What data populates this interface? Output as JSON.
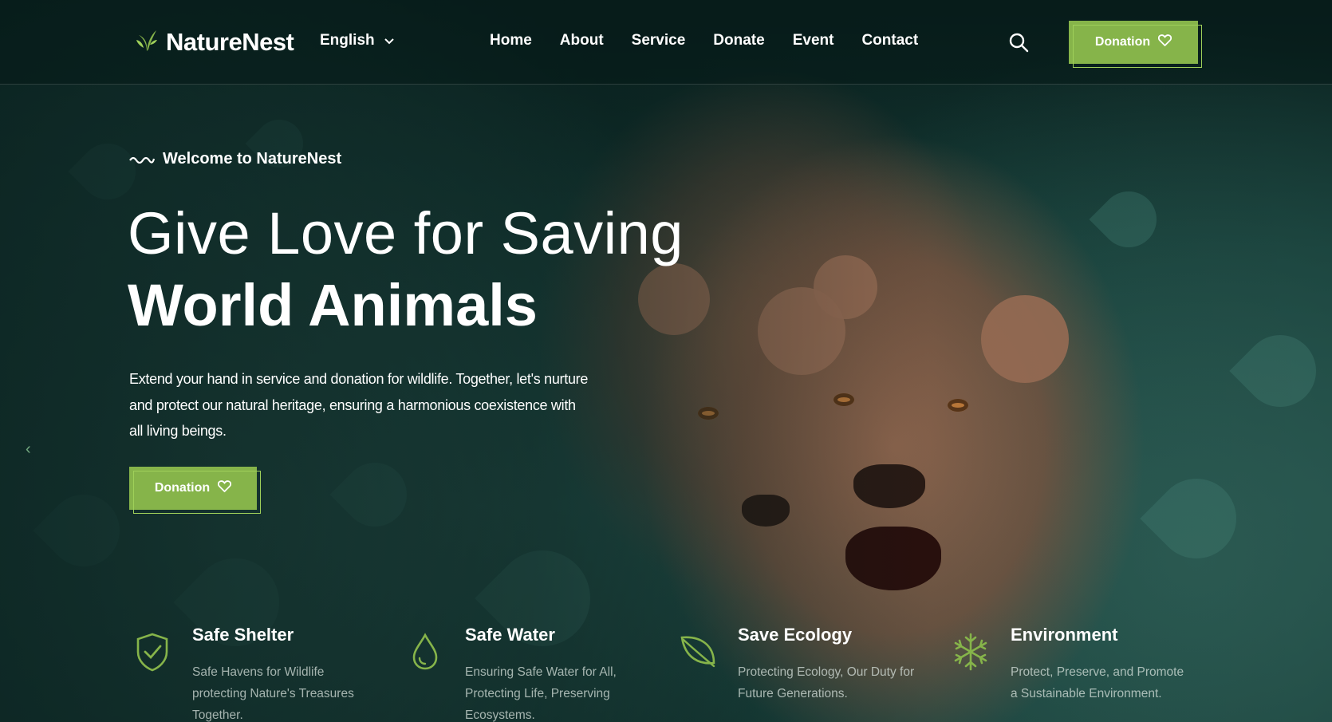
{
  "brand": {
    "name": "NatureNest",
    "accent": "#86b44a"
  },
  "header": {
    "language": "English",
    "nav": [
      "Home",
      "About",
      "Service",
      "Donate",
      "Event",
      "Contact"
    ],
    "donate_label": "Donation"
  },
  "hero": {
    "eyebrow": "Welcome to NatureNest",
    "title_line1": "Give Love for Saving",
    "title_line2": "World Animals",
    "description": "Extend your hand in service and donation for wildlife. Together, let's nurture and protect our natural heritage, ensuring a harmonious coexistence with all living beings.",
    "donate_label": "Donation"
  },
  "features": [
    {
      "icon": "shield-check-icon",
      "title": "Safe Shelter",
      "description": "Safe Havens for Wildlife protecting Nature's Treasures Together."
    },
    {
      "icon": "water-drop-icon",
      "title": "Safe Water",
      "description": "Ensuring Safe Water for All, Protecting Life, Preserving Ecosystems."
    },
    {
      "icon": "leaf-icon",
      "title": "Save Ecology",
      "description": "Protecting Ecology, Our Duty for Future Generations."
    },
    {
      "icon": "snowflake-icon",
      "title": "Environment",
      "description": "Protect, Preserve, and Promote a Sustainable Environment."
    }
  ]
}
